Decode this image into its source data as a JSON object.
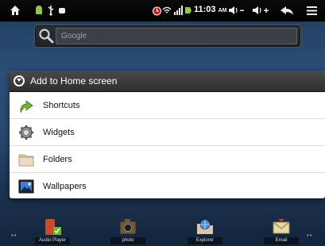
{
  "status_bar": {
    "time": "11:03",
    "am_pm": "AM",
    "icons": [
      "home-icon",
      "android-icon",
      "usb-icon",
      "android-debug-icon",
      "alarm-icon",
      "wifi-icon",
      "signal-icon",
      "battery-icon",
      "volume-down-icon",
      "volume-up-icon",
      "back-icon",
      "menu-icon"
    ]
  },
  "search": {
    "placeholder": "Google"
  },
  "dialog": {
    "title": "Add to Home screen",
    "items": [
      {
        "label": "Shortcuts",
        "icon": "green-arrow-icon"
      },
      {
        "label": "Widgets",
        "icon": "gear-icon"
      },
      {
        "label": "Folders",
        "icon": "folder-icon"
      },
      {
        "label": "Wallpapers",
        "icon": "picture-icon"
      }
    ]
  },
  "dock": {
    "items": [
      {
        "label": "Audio Player",
        "icon": "audio-player-icon"
      },
      {
        "label": "photo",
        "icon": "photo-icon"
      },
      {
        "label": "Explorer",
        "icon": "explorer-icon"
      },
      {
        "label": "Email",
        "icon": "email-icon"
      }
    ]
  },
  "colors": {
    "header_bg": "#3a3a3a",
    "accent_green": "#6ab42e"
  }
}
